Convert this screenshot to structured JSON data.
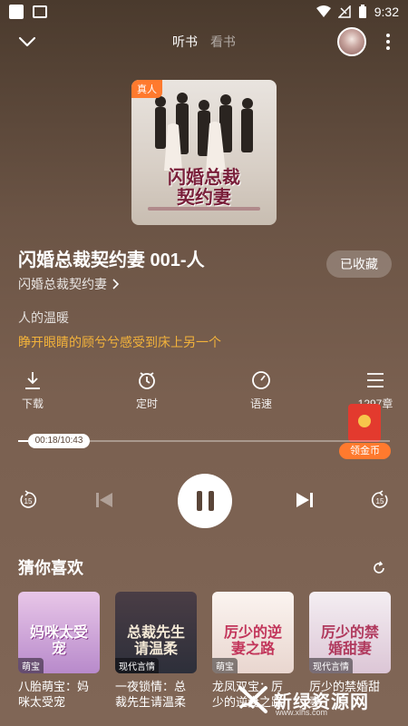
{
  "status_bar": {
    "time": "9:32"
  },
  "header": {
    "tabs": [
      {
        "label": "听书",
        "active": true
      },
      {
        "label": "看书",
        "active": false
      }
    ]
  },
  "cover": {
    "badge": "真人",
    "title_line1": "闪婚总裁",
    "title_line2": "契约妻"
  },
  "episode": {
    "title": "闪婚总裁契约妻 001-人",
    "book_name": "闪婚总裁契约妻",
    "favorite_label": "已收藏",
    "description_line1": "人的温暖",
    "description_line2": "睁开眼睛的顾兮兮感受到床上另一个"
  },
  "actions": [
    {
      "label": "下载",
      "icon": "download-icon"
    },
    {
      "label": "定时",
      "icon": "timer-icon"
    },
    {
      "label": "语速",
      "icon": "speed-icon"
    },
    {
      "label": "1297章",
      "icon": "chapter-list-icon"
    }
  ],
  "reward": {
    "coin_label": "领金币"
  },
  "player": {
    "time": "00:18/10:43",
    "progress": 0.028,
    "rewind_seconds": "15",
    "forward_seconds": "15"
  },
  "recommend": {
    "header": "猜你喜欢",
    "items": [
      {
        "title": "八胎萌宝：妈咪太受宠",
        "tag": "萌宝",
        "cover_text": "妈咪太受宠",
        "color": "#b88acb"
      },
      {
        "title": "一夜锁情：总裁先生请温柔",
        "tag": "现代言情",
        "cover_text": "总裁先生请温柔",
        "color": "#2d2f3a"
      },
      {
        "title": "龙凤双宝：厉少的逆妻之路",
        "tag": "萌宝",
        "cover_text": "厉少的逆妻之路",
        "color": "#f1e6e2"
      },
      {
        "title": "厉少的禁婚甜妻",
        "tag": "现代言情",
        "cover_text": "厉少的禁婚甜妻",
        "color": "#e9dce4"
      }
    ]
  },
  "watermark": {
    "name": "新绿资源网",
    "url": "www.xlhs.com"
  },
  "colors": {
    "accent": "#ff7a2e",
    "highlight": "#f2b23b",
    "reward": "#e33a2e"
  }
}
